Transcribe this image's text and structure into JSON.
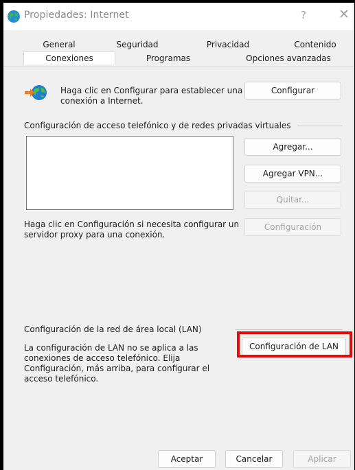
{
  "window": {
    "title": "Propiedades: Internet",
    "help": "?",
    "close": "✕"
  },
  "tabs": {
    "row1": [
      "General",
      "Seguridad",
      "Privacidad",
      "Contenido"
    ],
    "row2": [
      "Conexiones",
      "Programas",
      "Opciones avanzadas"
    ],
    "selected": "Conexiones"
  },
  "connection": {
    "setup_text_line1": "Haga clic en Configurar para establecer una",
    "setup_text_line2": "conexión a Internet.",
    "setup_button": "Configurar"
  },
  "dialup": {
    "section_title": "Configuración de acceso telefónico y de redes privadas virtuales",
    "items": [],
    "add_button": "Agregar...",
    "add_vpn_button": "Agregar VPN...",
    "remove_button": "Quitar...",
    "proxy_text_line1": "Haga clic en Configuración si necesita configurar un",
    "proxy_text_line2": "servidor proxy para una conexión.",
    "settings_button": "Configuración"
  },
  "lan": {
    "section_title": "Configuración de la red de área local (LAN)",
    "text_line1": "La configuración de LAN no se aplica a las",
    "text_line2": "conexiones de acceso telefónico. Elija",
    "text_line3": "Configuración, más arriba, para configurar el",
    "text_line4": "acceso telefónico.",
    "lan_button": "Configuración de LAN"
  },
  "footer": {
    "ok": "Aceptar",
    "cancel": "Cancelar",
    "apply": "Aplicar"
  },
  "colors": {
    "highlight": "#e30b0b",
    "dialog_bg": "#f0f0f0"
  }
}
